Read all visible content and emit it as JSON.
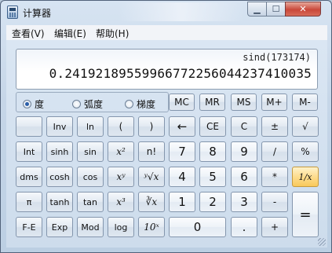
{
  "window": {
    "title": "计算器"
  },
  "menu": [
    {
      "label": "查看(V)"
    },
    {
      "label": "编辑(E)"
    },
    {
      "label": "帮助(H)"
    }
  ],
  "display": {
    "expression": "sind(173174)",
    "result": "0.24192189559966772256044237410035"
  },
  "angle_units": [
    {
      "label": "度",
      "selected": true
    },
    {
      "label": "弧度",
      "selected": false
    },
    {
      "label": "梯度",
      "selected": false
    }
  ],
  "buttons": {
    "memory": [
      "MC",
      "MR",
      "MS",
      "M+",
      "M-"
    ],
    "row2": [
      "",
      "Inv",
      "ln",
      "(",
      ")",
      "←",
      "CE",
      "C",
      "±",
      "√"
    ],
    "row3": [
      "Int",
      "sinh",
      "sin",
      "x²",
      "n!",
      "7",
      "8",
      "9",
      "/",
      "%"
    ],
    "row4": [
      "dms",
      "cosh",
      "cos",
      "xʸ",
      "ʸ√x",
      "4",
      "5",
      "6",
      "*",
      "1/x"
    ],
    "row5": [
      "π",
      "tanh",
      "tan",
      "x³",
      "∛x",
      "1",
      "2",
      "3",
      "-",
      "="
    ],
    "row6": [
      "F-E",
      "Exp",
      "Mod",
      "log",
      "10ˣ",
      "0",
      ".",
      "+"
    ]
  },
  "colors": {
    "highlight": "#fddc8f",
    "close": "#c9483a"
  }
}
